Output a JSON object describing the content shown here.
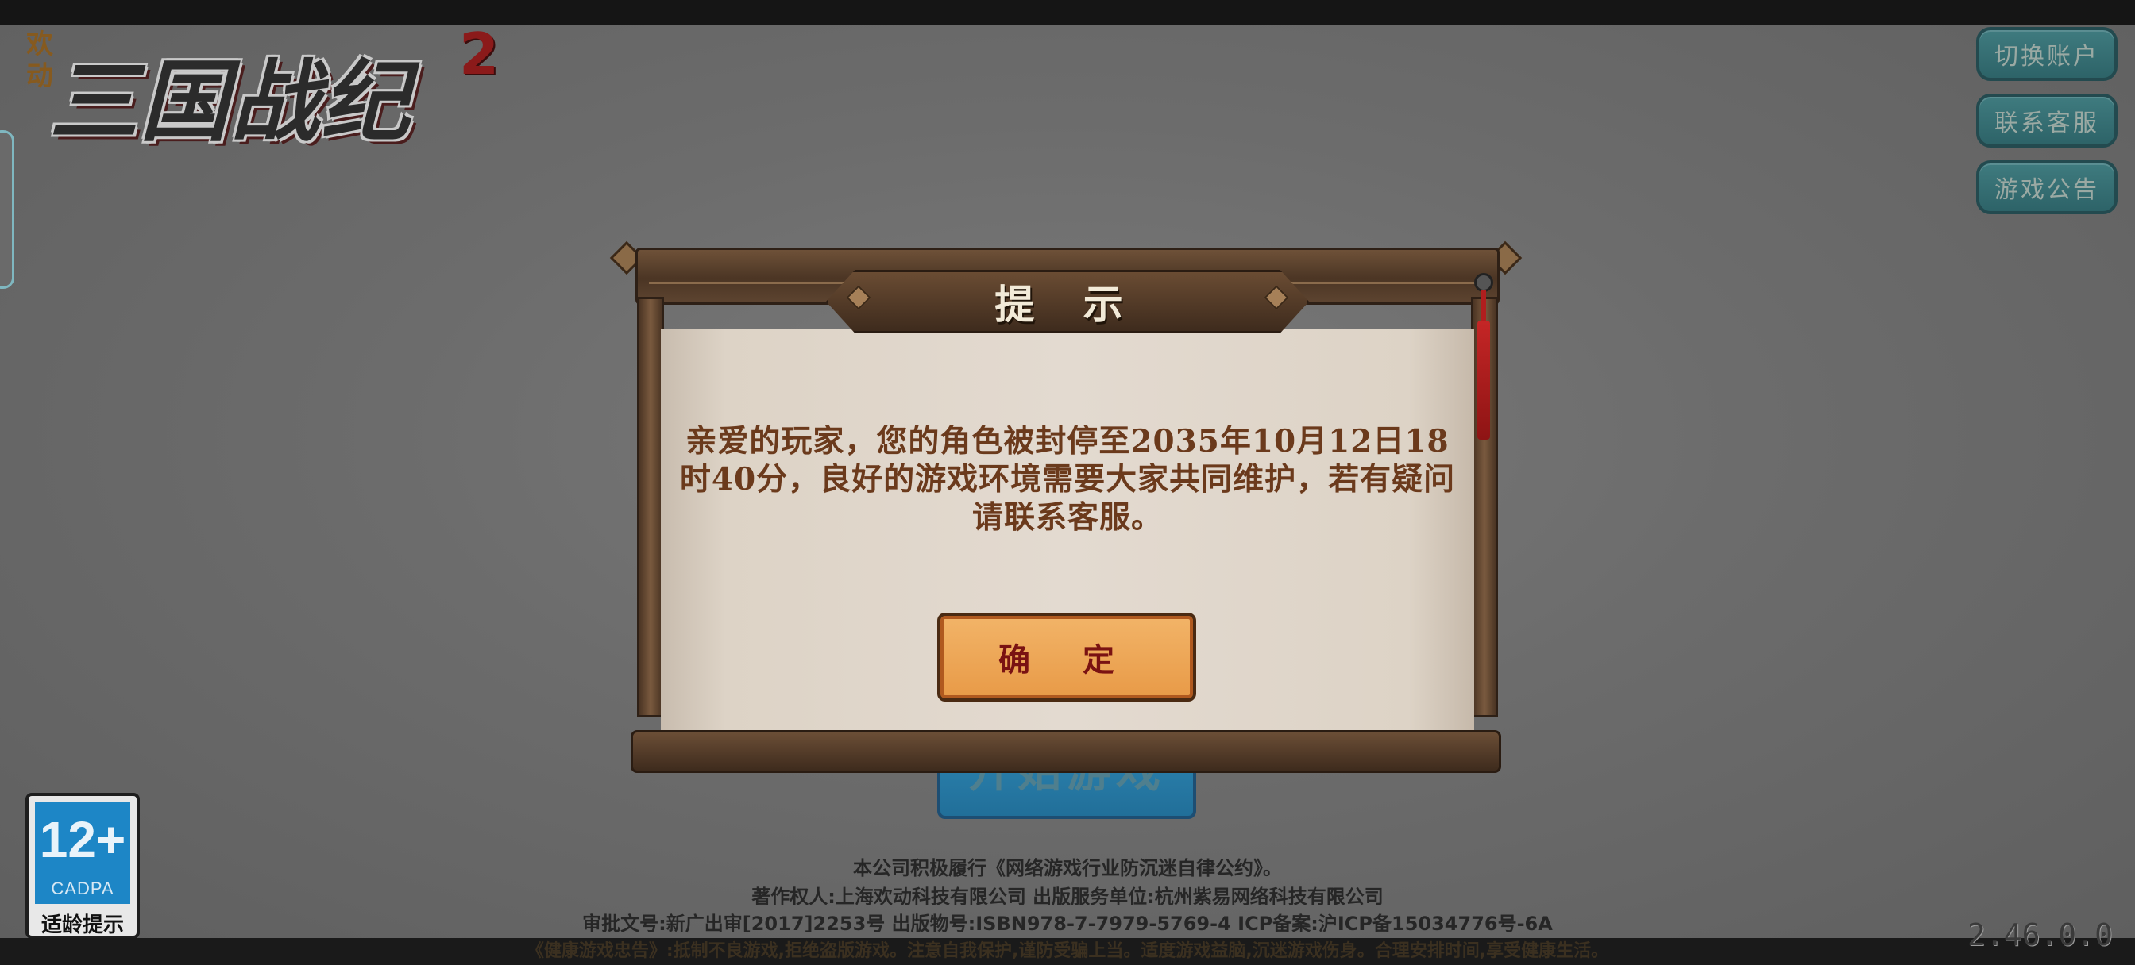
{
  "logo": {
    "small_text": "欢动",
    "main_text": "三国战纪",
    "number": "2"
  },
  "side_buttons": [
    {
      "label": "切换账户"
    },
    {
      "label": "联系客服"
    },
    {
      "label": "游戏公告"
    }
  ],
  "start_button": {
    "label": "开始游戏"
  },
  "dialog": {
    "title": "提 示",
    "message": "亲爱的玩家，您的角色被封停至2035年10月12日18时40分，良好的游戏环境需要大家共同维护，若有疑问请联系客服。",
    "confirm_label": "确 定"
  },
  "age_rating": {
    "age": "12+",
    "org": "CADPA",
    "label": "适龄提示"
  },
  "footer": {
    "line1": "本公司积极履行《网络游戏行业防沉迷自律公约》。",
    "line2": "著作权人:上海欢动科技有限公司 出版服务单位:杭州紫易网络科技有限公司",
    "line3": "审批文号:新广出审[2017]2253号 出版物号:ISBN978-7-7979-5769-4 ICP备案:沪ICP备15034776号-6A",
    "line4": "《健康游戏忠告》:抵制不良游戏,拒绝盗版游戏。注意自我保护,谨防受骗上当。适度游戏益脑,沉迷游戏伤身。合理安排时间,享受健康生活。"
  },
  "version": "2.46.0.0",
  "colors": {
    "dialog_text": "#6b3a1c",
    "confirm_button": "#f0ad5e",
    "side_button": "#3a7479"
  }
}
